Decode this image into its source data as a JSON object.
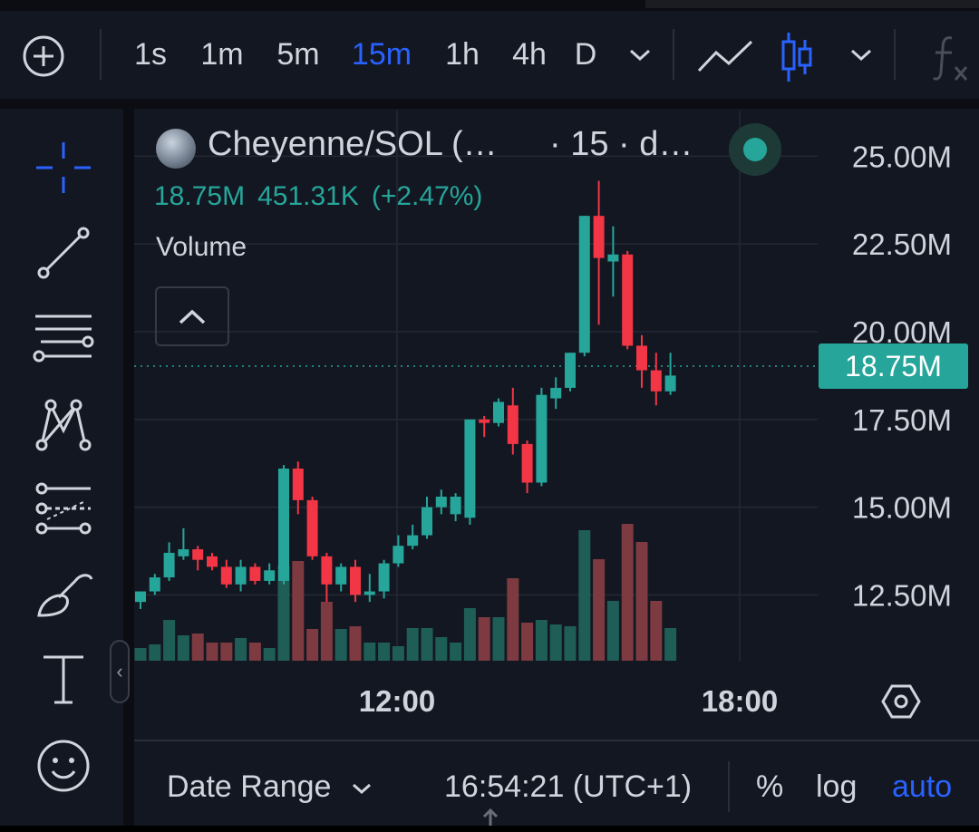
{
  "toolbar": {
    "timeframes": [
      "1s",
      "1m",
      "5m",
      "15m",
      "1h",
      "4h",
      "D"
    ],
    "active_timeframe": "15m"
  },
  "legend": {
    "pair": "Cheyenne/SOL (…",
    "interval": "· 15 · d…",
    "price": "18.75M",
    "change": "451.31K",
    "change_pct": "(+2.47%)",
    "volume_label": "Volume"
  },
  "price_tag": "18.75M",
  "bottom": {
    "date_range": "Date Range",
    "time": "16:54:21 (UTC+1)",
    "pct": "%",
    "log": "log",
    "auto": "auto"
  },
  "colors": {
    "up": "#26a69a",
    "down": "#f23645",
    "accent": "#2962ff",
    "volume_up": "#1f5e57",
    "volume_down": "#7d3a40"
  },
  "chart_data": {
    "type": "candlestick",
    "ylim": [
      10.6,
      26.3
    ],
    "y_ticks": [
      25.0,
      22.5,
      20.0,
      17.5,
      15.0,
      12.5
    ],
    "y_tick_labels": [
      "25.00M",
      "22.50M",
      "20.00M",
      "17.50M",
      "15.00M",
      "12.50M"
    ],
    "x_ticks": [
      "12:00",
      "18:00"
    ],
    "last_price": 18.75,
    "candles": [
      {
        "o": 12.3,
        "h": 12.4,
        "l": 12.1,
        "c": 12.6,
        "v": 14
      },
      {
        "o": 12.6,
        "h": 13.1,
        "l": 12.5,
        "c": 13.0,
        "v": 18
      },
      {
        "o": 13.0,
        "h": 14.0,
        "l": 12.9,
        "c": 13.7,
        "v": 45
      },
      {
        "o": 13.6,
        "h": 14.4,
        "l": 13.5,
        "c": 13.8,
        "v": 28
      },
      {
        "o": 13.8,
        "h": 13.9,
        "l": 13.2,
        "c": 13.5,
        "v": 30
      },
      {
        "o": 13.6,
        "h": 13.7,
        "l": 13.2,
        "c": 13.3,
        "v": 20
      },
      {
        "o": 13.3,
        "h": 13.5,
        "l": 12.7,
        "c": 12.8,
        "v": 20
      },
      {
        "o": 12.8,
        "h": 13.5,
        "l": 12.6,
        "c": 13.3,
        "v": 25
      },
      {
        "o": 13.3,
        "h": 13.4,
        "l": 12.8,
        "c": 12.9,
        "v": 20
      },
      {
        "o": 12.9,
        "h": 13.4,
        "l": 12.8,
        "c": 13.2,
        "v": 14
      },
      {
        "o": 12.9,
        "h": 16.2,
        "l": 12.8,
        "c": 16.1,
        "v": 105
      },
      {
        "o": 16.1,
        "h": 16.3,
        "l": 14.8,
        "c": 15.2,
        "v": 110
      },
      {
        "o": 15.2,
        "h": 15.3,
        "l": 13.5,
        "c": 13.6,
        "v": 35
      },
      {
        "o": 13.6,
        "h": 13.7,
        "l": 12.3,
        "c": 12.8,
        "v": 65
      },
      {
        "o": 12.8,
        "h": 13.4,
        "l": 12.6,
        "c": 13.3,
        "v": 35
      },
      {
        "o": 13.3,
        "h": 13.5,
        "l": 12.3,
        "c": 12.5,
        "v": 38
      },
      {
        "o": 12.5,
        "h": 13.1,
        "l": 12.3,
        "c": 12.6,
        "v": 20
      },
      {
        "o": 12.6,
        "h": 13.5,
        "l": 12.4,
        "c": 13.4,
        "v": 20
      },
      {
        "o": 13.4,
        "h": 14.2,
        "l": 13.3,
        "c": 13.9,
        "v": 16
      },
      {
        "o": 13.9,
        "h": 14.5,
        "l": 13.8,
        "c": 14.2,
        "v": 36
      },
      {
        "o": 14.2,
        "h": 15.3,
        "l": 14.1,
        "c": 15.0,
        "v": 36
      },
      {
        "o": 15.0,
        "h": 15.5,
        "l": 14.8,
        "c": 15.3,
        "v": 26
      },
      {
        "o": 14.8,
        "h": 15.4,
        "l": 14.6,
        "c": 15.3,
        "v": 20
      },
      {
        "o": 14.7,
        "h": 17.4,
        "l": 14.5,
        "c": 17.5,
        "v": 58
      },
      {
        "o": 17.5,
        "h": 17.6,
        "l": 17.0,
        "c": 17.4,
        "v": 48
      },
      {
        "o": 17.4,
        "h": 18.1,
        "l": 17.3,
        "c": 18.0,
        "v": 48
      },
      {
        "o": 17.9,
        "h": 18.4,
        "l": 16.5,
        "c": 16.8,
        "v": 91
      },
      {
        "o": 16.8,
        "h": 16.9,
        "l": 15.4,
        "c": 15.7,
        "v": 42
      },
      {
        "o": 15.7,
        "h": 18.4,
        "l": 15.6,
        "c": 18.2,
        "v": 45
      },
      {
        "o": 18.1,
        "h": 18.7,
        "l": 17.8,
        "c": 18.4,
        "v": 40
      },
      {
        "o": 18.4,
        "h": 19.4,
        "l": 18.3,
        "c": 19.4,
        "v": 38
      },
      {
        "o": 19.4,
        "h": 23.3,
        "l": 19.3,
        "c": 23.3,
        "v": 144
      },
      {
        "o": 23.3,
        "h": 24.3,
        "l": 20.2,
        "c": 22.1,
        "v": 112
      },
      {
        "o": 22.0,
        "h": 23.0,
        "l": 21.0,
        "c": 22.2,
        "v": 66
      },
      {
        "o": 22.2,
        "h": 22.3,
        "l": 19.5,
        "c": 19.6,
        "v": 151
      },
      {
        "o": 19.6,
        "h": 19.9,
        "l": 18.4,
        "c": 18.9,
        "v": 131
      },
      {
        "o": 18.9,
        "h": 19.4,
        "l": 17.9,
        "c": 18.3,
        "v": 66
      },
      {
        "o": 18.3,
        "h": 19.4,
        "l": 18.2,
        "c": 18.75,
        "v": 36
      }
    ]
  }
}
